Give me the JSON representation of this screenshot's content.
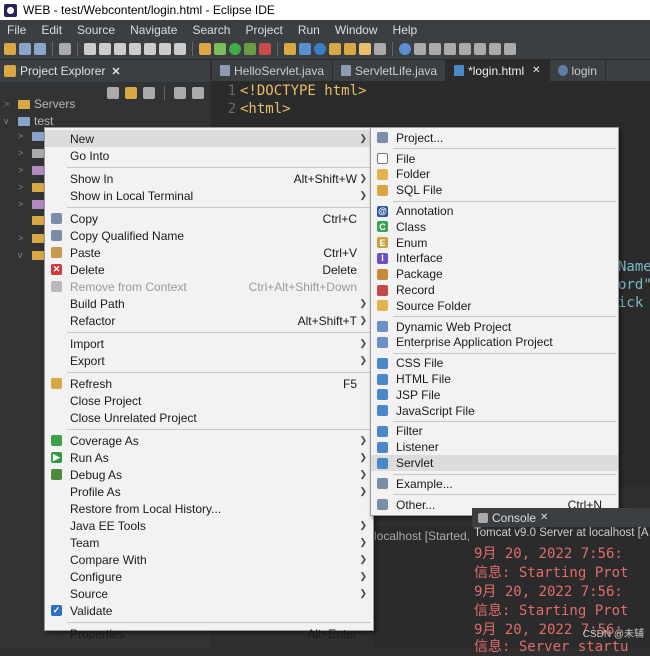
{
  "window": {
    "title": "WEB - test/Webcontent/login.html - Eclipse IDE"
  },
  "menubar": [
    "File",
    "Edit",
    "Source",
    "Navigate",
    "Search",
    "Project",
    "Run",
    "Window",
    "Help"
  ],
  "explorer": {
    "title": "Project Explorer",
    "close": "✕",
    "tree": [
      {
        "label": "Servers",
        "expanded": false
      },
      {
        "label": "test",
        "expanded": true
      }
    ]
  },
  "tabs": [
    {
      "label": "HelloServlet.java",
      "icon": "java-file-icon"
    },
    {
      "label": "ServletLife.java",
      "icon": "java-file-icon"
    },
    {
      "label": "*login.html",
      "icon": "html-file-icon",
      "active": true,
      "close": "✕"
    },
    {
      "label": "login",
      "icon": "globe-icon"
    }
  ],
  "editor": {
    "lines": [
      {
        "num": "1",
        "parts": [
          "<!DOCTYPE html>"
        ]
      },
      {
        "num": "2",
        "parts": [
          "<html>"
        ]
      }
    ],
    "fragments": [
      "Name",
      "ord\"",
      "ick"
    ]
  },
  "context_menu": {
    "items": [
      {
        "label": "New",
        "submenu": true,
        "hover": true
      },
      {
        "label": "Go Into"
      },
      {
        "sep": true
      },
      {
        "label": "Show In",
        "shortcut": "Alt+Shift+W",
        "submenu": true
      },
      {
        "label": "Show in Local Terminal",
        "submenu": true
      },
      {
        "sep": true
      },
      {
        "label": "Copy",
        "shortcut": "Ctrl+C",
        "icon": "copy-icon"
      },
      {
        "label": "Copy Qualified Name",
        "icon": "copy-qualified-icon"
      },
      {
        "label": "Paste",
        "shortcut": "Ctrl+V",
        "icon": "paste-icon"
      },
      {
        "label": "Delete",
        "shortcut": "Delete",
        "icon": "delete-icon"
      },
      {
        "label": "Remove from Context",
        "shortcut": "Ctrl+Alt+Shift+Down",
        "disabled": true,
        "icon": "remove-context-icon"
      },
      {
        "label": "Build Path",
        "submenu": true
      },
      {
        "label": "Refactor",
        "shortcut": "Alt+Shift+T",
        "submenu": true
      },
      {
        "sep": true
      },
      {
        "label": "Import",
        "submenu": true
      },
      {
        "label": "Export",
        "submenu": true
      },
      {
        "sep": true
      },
      {
        "label": "Refresh",
        "shortcut": "F5",
        "icon": "refresh-icon"
      },
      {
        "label": "Close Project"
      },
      {
        "label": "Close Unrelated Project"
      },
      {
        "sep": true
      },
      {
        "label": "Coverage As",
        "submenu": true,
        "icon": "coverage-icon"
      },
      {
        "label": "Run As",
        "submenu": true,
        "icon": "run-icon"
      },
      {
        "label": "Debug As",
        "submenu": true,
        "icon": "debug-icon"
      },
      {
        "label": "Profile As",
        "submenu": true
      },
      {
        "label": "Restore from Local History..."
      },
      {
        "label": "Java EE Tools",
        "submenu": true
      },
      {
        "label": "Team",
        "submenu": true
      },
      {
        "label": "Compare With",
        "submenu": true
      },
      {
        "label": "Configure",
        "submenu": true
      },
      {
        "label": "Source",
        "submenu": true
      },
      {
        "label": "Validate",
        "icon": "checkbox-checked-icon"
      },
      {
        "sep": true
      },
      {
        "label": "Properties",
        "shortcut": "Alt+Enter"
      }
    ]
  },
  "new_submenu": {
    "items": [
      {
        "label": "Project...",
        "icon": "project-icon"
      },
      {
        "sep": true
      },
      {
        "label": "File",
        "icon": "file-icon"
      },
      {
        "label": "Folder",
        "icon": "folder-icon"
      },
      {
        "label": "SQL File",
        "icon": "sql-file-icon"
      },
      {
        "sep": true
      },
      {
        "label": "Annotation",
        "icon": "annotation-icon"
      },
      {
        "label": "Class",
        "icon": "class-icon"
      },
      {
        "label": "Enum",
        "icon": "enum-icon"
      },
      {
        "label": "Interface",
        "icon": "interface-icon"
      },
      {
        "label": "Package",
        "icon": "package-icon"
      },
      {
        "label": "Record",
        "icon": "record-icon"
      },
      {
        "label": "Source Folder",
        "icon": "source-folder-icon"
      },
      {
        "sep": true
      },
      {
        "label": "Dynamic Web Project",
        "icon": "web-project-icon"
      },
      {
        "label": "Enterprise Application Project",
        "icon": "ear-project-icon"
      },
      {
        "sep": true
      },
      {
        "label": "CSS File",
        "icon": "css-file-icon"
      },
      {
        "label": "HTML File",
        "icon": "html-file-icon"
      },
      {
        "label": "JSP File",
        "icon": "jsp-file-icon"
      },
      {
        "label": "JavaScript File",
        "icon": "js-file-icon"
      },
      {
        "sep": true
      },
      {
        "label": "Filter",
        "icon": "filter-icon"
      },
      {
        "label": "Listener",
        "icon": "listener-icon"
      },
      {
        "label": "Servlet",
        "icon": "servlet-icon",
        "hover": true
      },
      {
        "sep": true
      },
      {
        "label": "Example...",
        "icon": "example-icon"
      },
      {
        "sep": true
      },
      {
        "label": "Other...",
        "shortcut": "Ctrl+N",
        "icon": "other-icon"
      }
    ]
  },
  "servers_panel": {
    "text": "localhost  [Started, S"
  },
  "console": {
    "tab": "Console",
    "close": "✕",
    "server_info": "Tomcat v9.0 Server at localhost [A",
    "lines": [
      "9月 20, 2022 7:56:",
      "信息: Starting Prot",
      "9月 20, 2022 7:56:",
      "信息: Starting Prot",
      "9月 20, 2022 7:56:",
      "信息: Server startu"
    ]
  },
  "watermark": "CSDN @未辅"
}
